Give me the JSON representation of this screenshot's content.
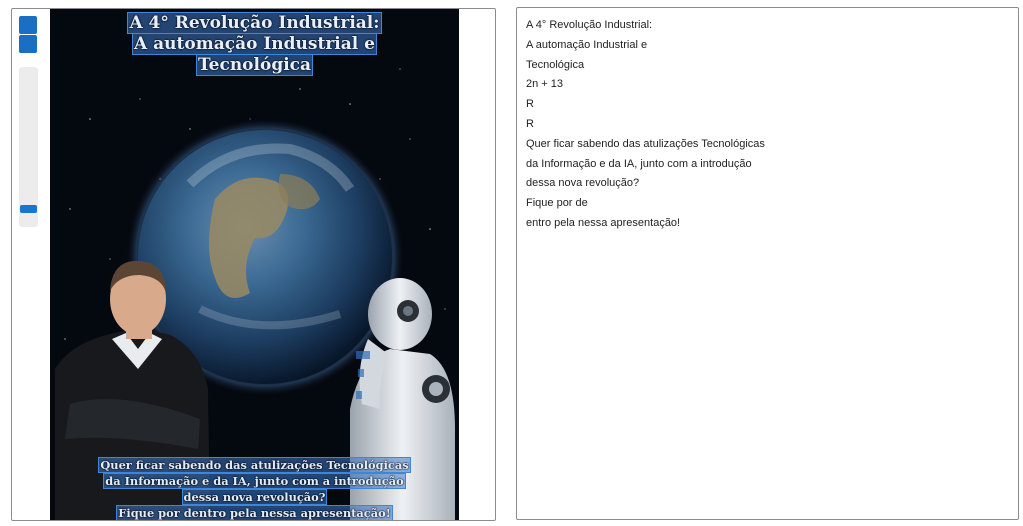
{
  "viewer": {
    "slider_value": 0.91
  },
  "image": {
    "title_lines": [
      "A 4° Revolução Industrial:",
      "A automação Industrial e",
      "Tecnológica"
    ],
    "caption_lines": [
      "Quer ficar sabendo das atulizações Tecnológicas",
      "da Informação e da IA, junto com a introdução",
      "dessa nova revolução?",
      "Fique por dentro pela nessa apresentação!"
    ]
  },
  "text_output": {
    "lines": [
      "A 4° Revolução Industrial:",
      "A automação Industrial e",
      "Tecnológica",
      "2n + 13",
      "R",
      "R",
      "Quer ficar sabendo das atulizações Tecnológicas",
      "da Informação e da IA, junto com a introdução",
      "dessa nova revolução?",
      "Fique por de",
      "entro pela nessa apresentação!"
    ]
  },
  "colors": {
    "accent": "#1a6fc2",
    "panel_border": "#8c8c8c",
    "highlight": "#3f86d6"
  }
}
